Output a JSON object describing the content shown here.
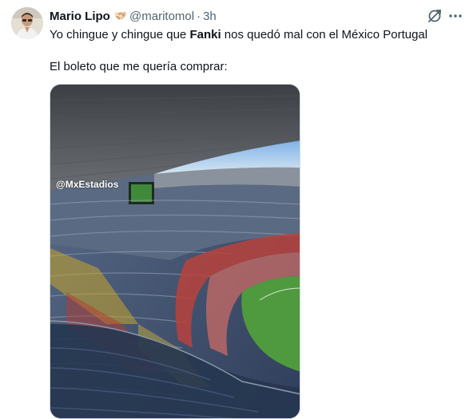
{
  "author": {
    "name": "Mario Lipo",
    "emoji": "🫱🏻‍🫲🏼",
    "handle": "@maritomol",
    "separator": "·",
    "time": "3h"
  },
  "tweet": {
    "line1_before": "Yo chingue y chingue que ",
    "line1_bold": "Fanki",
    "line1_after": " nos quedó mal con el México Portugal",
    "line2": "El boleto que me quería comprar:"
  },
  "media": {
    "watermark": "@MxEstadios"
  },
  "icons": {
    "grok": "grok-icon",
    "more": "more-icon"
  },
  "colors": {
    "text": "#0f1419",
    "secondary": "#536471"
  }
}
